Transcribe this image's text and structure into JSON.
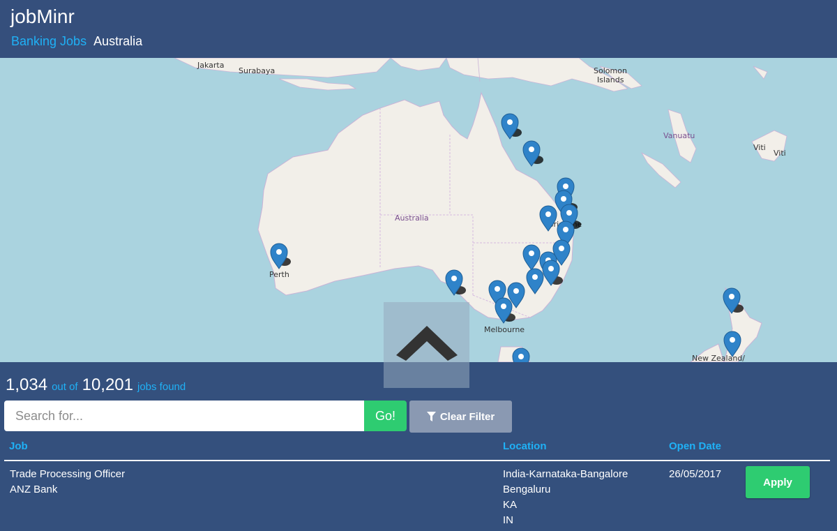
{
  "header": {
    "title": "jobMinr",
    "breadcrumb_link": "Banking Jobs",
    "breadcrumb_current": "Australia"
  },
  "map": {
    "labels": {
      "jakarta": "Jakarta",
      "surabaya": "Surabaya",
      "solomon1": "Solomon",
      "solomon2": "Islands",
      "vanuatu": "Vanuatu",
      "viti1": "Viti",
      "viti2": "Viti",
      "australia": "Australia",
      "perth": "Perth",
      "brisbane": "Brisbane",
      "melbourne": "Melbourne",
      "new_zealand": "New Zealand/"
    },
    "colors": {
      "water": "#aad3df",
      "land": "#f2efe9",
      "marker": "#2f83c9"
    },
    "marker_icon": "map-marker-icon",
    "toggle_icon": "chevron-up-icon"
  },
  "results": {
    "count": "1,034",
    "out_of_label": "out of",
    "total": "10,201",
    "found_label": "jobs found"
  },
  "search": {
    "placeholder": "Search for...",
    "go_label": "Go!",
    "clear_label": "Clear Filter",
    "clear_icon": "filter-icon"
  },
  "table": {
    "headers": {
      "job": "Job",
      "location": "Location",
      "open_date": "Open Date"
    },
    "rows": [
      {
        "title": "Trade Processing Officer",
        "company": "ANZ Bank",
        "location": [
          "India-Karnataka-Bangalore",
          "Bengaluru",
          "KA",
          "IN"
        ],
        "open_date": "26/05/2017",
        "apply_label": "Apply"
      }
    ]
  },
  "colors": {
    "background": "#34507d",
    "accent": "#1fb1f6",
    "button_green": "#2ecc71",
    "button_grey": "#8a99b2"
  }
}
